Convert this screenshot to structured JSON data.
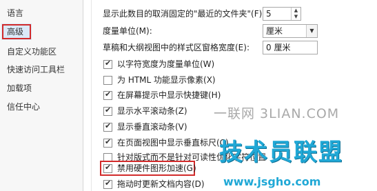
{
  "nav": {
    "items": [
      {
        "label": "语言",
        "selected": false
      },
      {
        "label": "高级",
        "selected": true
      },
      {
        "label": "自定义功能区",
        "selected": false
      },
      {
        "label": "快速访问工具栏",
        "selected": false
      },
      {
        "label": "加载项",
        "selected": false
      },
      {
        "label": "信任中心",
        "selected": false
      }
    ]
  },
  "options": {
    "recent_folders": {
      "label": "显示此数目的取消固定的\"最近的文件夹\"(F):",
      "value": "5"
    },
    "measure_unit": {
      "label": "度量单位(M):",
      "value": "厘米"
    },
    "style_pane_width": {
      "label": "草稿和大纲视图中的样式区窗格宽度(E):",
      "value": "0 厘米"
    },
    "checkboxes": [
      {
        "label": "以字符宽度为度量单位(W)",
        "checked": true
      },
      {
        "label": "为 HTML 功能显示像素(X)",
        "checked": false
      },
      {
        "label": "在屏幕提示中显示快捷键(H)",
        "checked": true
      },
      {
        "label": "显示水平滚动条(Z)",
        "checked": true
      },
      {
        "label": "显示垂直滚动条(V)",
        "checked": true
      },
      {
        "label": "在页面视图中显示垂直标尺(C)",
        "checked": true
      },
      {
        "label": "针对版式而不是针对可读性优化字符位置",
        "checked": false
      },
      {
        "label": "禁用硬件图形加速(G)",
        "checked": true
      },
      {
        "label": "拖动时更新文档内容(D)",
        "checked": true
      }
    ]
  },
  "watermarks": {
    "line1": "一联网 3LIAN.COM",
    "line2": "技术员联盟",
    "line3": "www.jsgho.com"
  },
  "colors": {
    "highlight": "#d22a2a",
    "selection": "#dbe9f8",
    "brand": "#20a8d6"
  }
}
